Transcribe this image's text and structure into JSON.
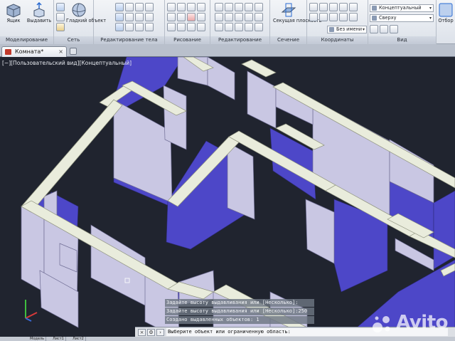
{
  "ribbon": {
    "modeling": {
      "title": "Моделирование",
      "box_label": "Ящик",
      "extrude_label": "Выдавить"
    },
    "mesh": {
      "title": "Сеть",
      "smooth_label": "Гладкий объект"
    },
    "solid_edit": {
      "title": "Редактирование тела"
    },
    "draw": {
      "title": "Рисование"
    },
    "edit": {
      "title": "Редактирование"
    },
    "section": {
      "title": "Сечение",
      "plane_label": "Секущая плоскость"
    },
    "coords": {
      "title": "Координаты"
    },
    "view": {
      "title": "Вид",
      "visual_style": "Концептуальный",
      "view_direction": "Сверху",
      "named_view": "Без имени"
    },
    "select": {
      "label": "Отбор"
    }
  },
  "tabs": {
    "document": "Комната*"
  },
  "viewport": {
    "label": "[−][Пользовательский вид][Концептуальный]"
  },
  "command": {
    "history": [
      "Задайте высоту выдавливания или [Несколько]:",
      "Задайте высоту выдавливания или [Несколько]:250",
      "Создано выдавленных объектов: 1"
    ],
    "prompt": "Выберите объект или ограниченную область:"
  },
  "statusbar": {
    "model": "Модель",
    "layout1": "Лист1",
    "layout2": "Лист2"
  },
  "watermark": {
    "text": "Avito"
  },
  "colors": {
    "wall_face": "#c9c7e3",
    "wall_top": "#e9ecdc",
    "wall_inner": "#4d47c8",
    "background": "#20242f"
  }
}
